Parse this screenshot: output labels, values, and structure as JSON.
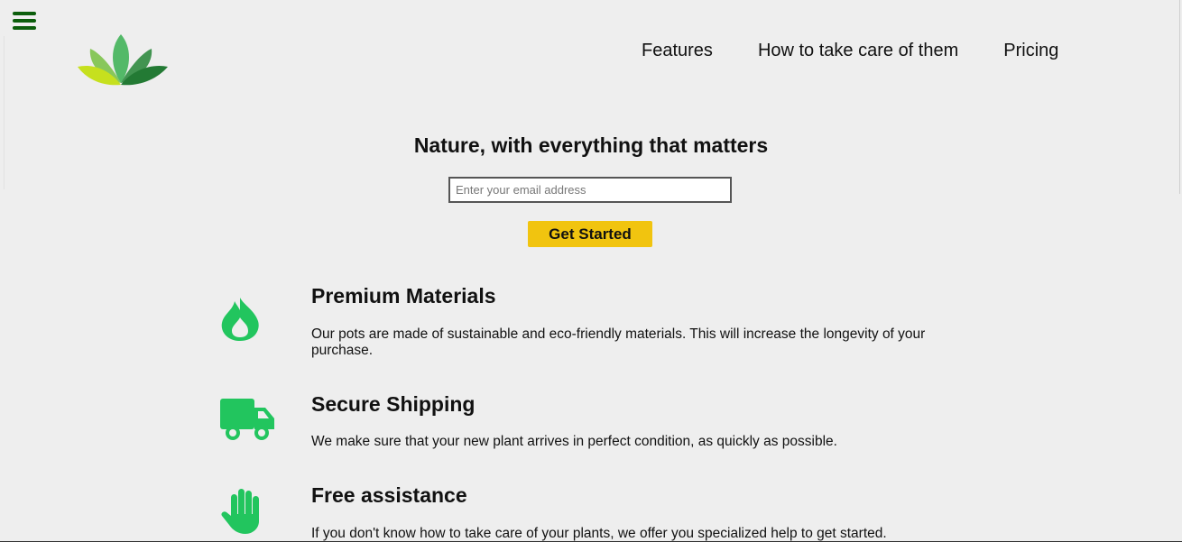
{
  "header": {
    "nav": {
      "items": [
        {
          "label": "Features"
        },
        {
          "label": "How to take care of them"
        },
        {
          "label": "Pricing"
        }
      ]
    }
  },
  "hero": {
    "title": "Nature, with everything that matters",
    "email_placeholder": "Enter your email address",
    "email_value": "",
    "cta_label": "Get Started"
  },
  "features": [
    {
      "icon": "fire-icon",
      "title": "Premium Materials",
      "text": "Our pots are made of sustainable and eco-friendly materials. This will increase the longevity of your purchase."
    },
    {
      "icon": "truck-icon",
      "title": "Secure Shipping",
      "text": "We make sure that your new plant arrives in perfect condition, as quickly as possible."
    },
    {
      "icon": "hand-icon",
      "title": "Free assistance",
      "text": "If you don't know how to take care of your plants, we offer you specialized help to get started."
    }
  ],
  "colors": {
    "background": "#eeeeee",
    "accent_yellow": "#f1c40f",
    "icon_green": "#22c55e",
    "menu_green": "#0b5d0b"
  }
}
